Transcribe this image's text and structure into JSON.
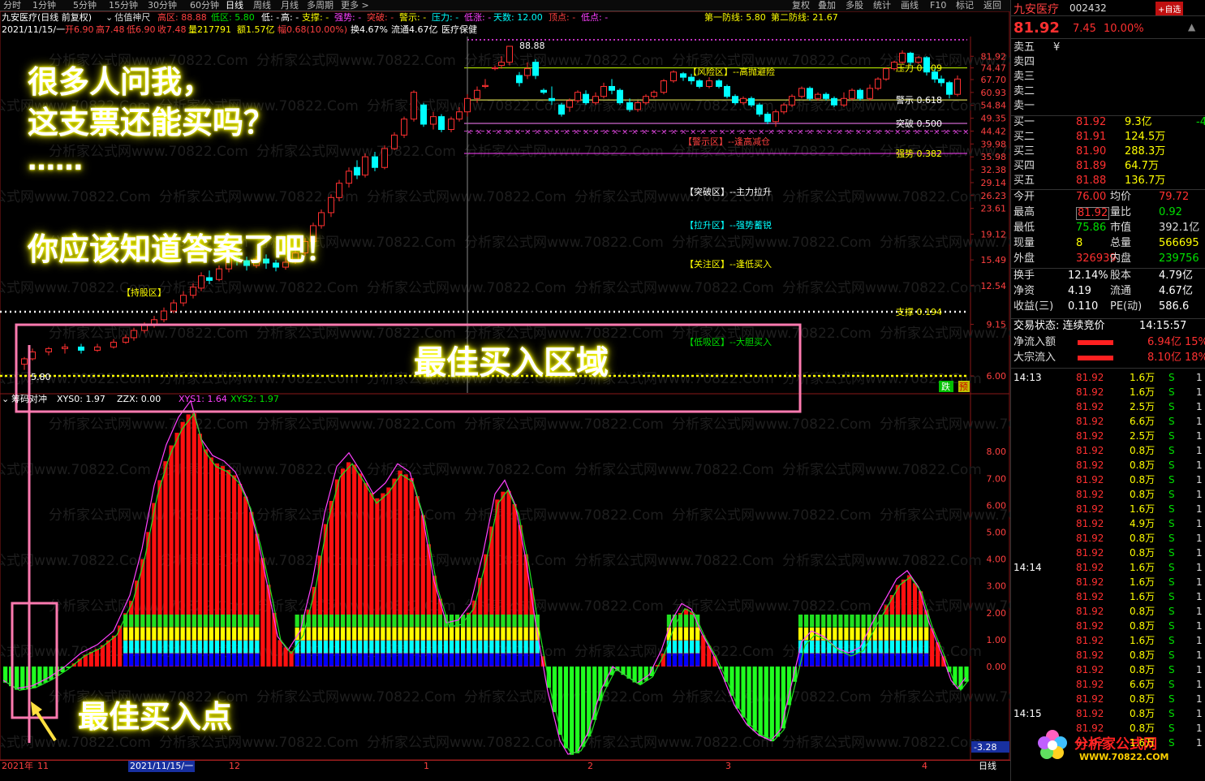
{
  "toolbar": {
    "tabs": [
      "分时",
      "1分钟",
      "5分钟",
      "15分钟",
      "30分钟",
      "60分钟",
      "日线",
      "周线",
      "月线",
      "多周期",
      "更多 >"
    ],
    "right": [
      "复权",
      "叠加",
      "多股",
      "统计",
      "画线",
      "F10",
      "标记",
      "返回"
    ]
  },
  "info": {
    "name": "九安医疗(日线 前复权)",
    "indicator": "估值神尺",
    "hi_zone": "高区: 88.88",
    "lo_zone": "低区: 5.80",
    "low": "低: -",
    "high": "高: -",
    "support": "支撑: -",
    "strong": "强势: -",
    "breakthrough": "突破: -",
    "warn": "警示: -",
    "pressure": "压力: -",
    "rise": "低涨: -",
    "days": "天数: 12.00",
    "top": "顶点: -",
    "lowpt": "低点: -",
    "line1": "第一防线: 5.80",
    "line2": "第二防线: 21.67"
  },
  "quote_line": {
    "date": "2021/11/15/一",
    "open": "开6.90",
    "high": "高7.48",
    "low": "低6.90",
    "close": "收7.48",
    "vol": "量217791",
    "amt": "额1.57亿",
    "amp": "幅0.68(10.00%)",
    "turn": "换4.67%",
    "flow": "流通4.67亿",
    "sector": "医疗保健"
  },
  "price_axis": [
    "81.92",
    "74.47",
    "67.70",
    "60.93",
    "54.84",
    "49.35",
    "44.42",
    "39.98",
    "35.98",
    "32.38",
    "29.14",
    "26.23",
    "23.61",
    "19.12",
    "15.49",
    "12.54",
    "9.15",
    "6.00"
  ],
  "zones": {
    "risk": "【风险区】--高抛避险",
    "warn": "【警示区】--逢高减仓",
    "break": "【突破区】--主力拉升",
    "lift": "【拉升区】--强势蓄锐",
    "watch": "【关注区】--逢低买入",
    "hold": "【持股区】",
    "absorb": "【低吸区】--大胆买入"
  },
  "fib": {
    "pressure": "压力 0.809",
    "warn": "警示 0.618",
    "break": "突破 0.500",
    "strong": "强势 0.382",
    "support": "支撑 0.194"
  },
  "peak_label": "88.88",
  "low_label": "5.80",
  "overlay": {
    "l1": "很多人问我，",
    "l2": "这支票还能买吗？",
    "l3": "……",
    "l4": "你应该知道答案了吧！",
    "zone": "最佳买入区域",
    "point": "最佳买入点"
  },
  "lower": {
    "title": "筹码对冲",
    "xys0": "XYS0: 1.97",
    "zzx": "ZZX: 0.00",
    "xys1": "XYS1: 1.64",
    "xys2": "XYS2: 1.97",
    "axis": [
      "8.00",
      "7.00",
      "6.00",
      "5.00",
      "4.00",
      "3.00",
      "2.00",
      "1.00",
      "0.00"
    ],
    "bottom_val": "-3.28"
  },
  "dates": {
    "y": "2021年",
    "m11": "11",
    "cursor": "2021/11/15/一",
    "m12": "12",
    "m1": "1",
    "m2": "2",
    "m3": "3",
    "m4": "4",
    "period": "日线"
  },
  "marks": {
    "m1": "跌",
    "m2": "预"
  },
  "watermark": "分析家公式网www.70822.Com",
  "right": {
    "name": "九安医疗",
    "code": "002432",
    "add": "+自选",
    "price": "81.92",
    "chg": "7.45",
    "pct": "10.00%",
    "asks": [
      {
        "l": "卖五",
        "p": "¥",
        "v": ""
      },
      {
        "l": "卖四",
        "p": "",
        "v": ""
      },
      {
        "l": "卖三",
        "p": "",
        "v": ""
      },
      {
        "l": "卖二",
        "p": "",
        "v": ""
      },
      {
        "l": "卖一",
        "p": "",
        "v": ""
      }
    ],
    "bids": [
      {
        "l": "买一",
        "p": "81.92",
        "v": "9.3亿",
        "x": "-4"
      },
      {
        "l": "买二",
        "p": "81.91",
        "v": "124.5万",
        "x": ""
      },
      {
        "l": "买三",
        "p": "81.90",
        "v": "288.3万",
        "x": ""
      },
      {
        "l": "买四",
        "p": "81.89",
        "v": "64.7万",
        "x": ""
      },
      {
        "l": "买五",
        "p": "81.88",
        "v": "136.7万",
        "x": ""
      }
    ],
    "stats": [
      {
        "a": "今开",
        "b": "76.00",
        "c": "均价",
        "d": "79.72"
      },
      {
        "a": "最高",
        "b": "81.92",
        "c": "量比",
        "d": "0.92"
      },
      {
        "a": "最低",
        "b": "75.86",
        "c": "市值",
        "d": "392.1亿"
      },
      {
        "a": "现量",
        "b": "8",
        "c": "总量",
        "d": "566695"
      },
      {
        "a": "外盘",
        "b": "326939",
        "c": "内盘",
        "d": "239756"
      }
    ],
    "stats2": [
      {
        "a": "换手",
        "b": "12.14%",
        "c": "股本",
        "d": "4.79亿"
      },
      {
        "a": "净资",
        "b": "4.19",
        "c": "流通",
        "d": "4.67亿"
      },
      {
        "a": "收益(三)",
        "b": "0.110",
        "c": "PE(动)",
        "d": "586.6"
      }
    ],
    "state": "交易状态: 连续竞价",
    "time": "14:15:57",
    "flow": [
      {
        "a": "净流入额",
        "b": "6.94亿",
        "c": "15%"
      },
      {
        "a": "大宗流入",
        "b": "8.10亿",
        "c": "18%"
      }
    ],
    "ticks": [
      {
        "t": "14:13",
        "p": "81.92",
        "v": "1.6万",
        "s": "S"
      },
      {
        "t": "",
        "p": "81.92",
        "v": "1.6万",
        "s": "S"
      },
      {
        "t": "",
        "p": "81.92",
        "v": "2.5万",
        "s": "S"
      },
      {
        "t": "",
        "p": "81.92",
        "v": "6.6万",
        "s": "S"
      },
      {
        "t": "",
        "p": "81.92",
        "v": "2.5万",
        "s": "S"
      },
      {
        "t": "",
        "p": "81.92",
        "v": "0.8万",
        "s": "S"
      },
      {
        "t": "",
        "p": "81.92",
        "v": "0.8万",
        "s": "S"
      },
      {
        "t": "",
        "p": "81.92",
        "v": "0.8万",
        "s": "S"
      },
      {
        "t": "",
        "p": "81.92",
        "v": "0.8万",
        "s": "S"
      },
      {
        "t": "",
        "p": "81.92",
        "v": "1.6万",
        "s": "S"
      },
      {
        "t": "",
        "p": "81.92",
        "v": "4.9万",
        "s": "S"
      },
      {
        "t": "",
        "p": "81.92",
        "v": "0.8万",
        "s": "S"
      },
      {
        "t": "",
        "p": "81.92",
        "v": "0.8万",
        "s": "S"
      },
      {
        "t": "14:14",
        "p": "81.92",
        "v": "1.6万",
        "s": "S"
      },
      {
        "t": "",
        "p": "81.92",
        "v": "1.6万",
        "s": "S"
      },
      {
        "t": "",
        "p": "81.92",
        "v": "1.6万",
        "s": "S"
      },
      {
        "t": "",
        "p": "81.92",
        "v": "0.8万",
        "s": "S"
      },
      {
        "t": "",
        "p": "81.92",
        "v": "0.8万",
        "s": "S"
      },
      {
        "t": "",
        "p": "81.92",
        "v": "1.6万",
        "s": "S"
      },
      {
        "t": "",
        "p": "81.92",
        "v": "0.8万",
        "s": "S"
      },
      {
        "t": "",
        "p": "81.92",
        "v": "0.8万",
        "s": "S"
      },
      {
        "t": "",
        "p": "81.92",
        "v": "6.6万",
        "s": "S"
      },
      {
        "t": "",
        "p": "81.92",
        "v": "0.8万",
        "s": "S"
      },
      {
        "t": "14:15",
        "p": "81.92",
        "v": "0.8万",
        "s": "S"
      },
      {
        "t": "",
        "p": "81.92",
        "v": "0.8万",
        "s": "S"
      },
      {
        "t": "",
        "p": "81.92",
        "v": "1.6万",
        "s": "S"
      }
    ],
    "logo1": "分析家公式网",
    "logo2": "WWW.70822.COM"
  }
}
